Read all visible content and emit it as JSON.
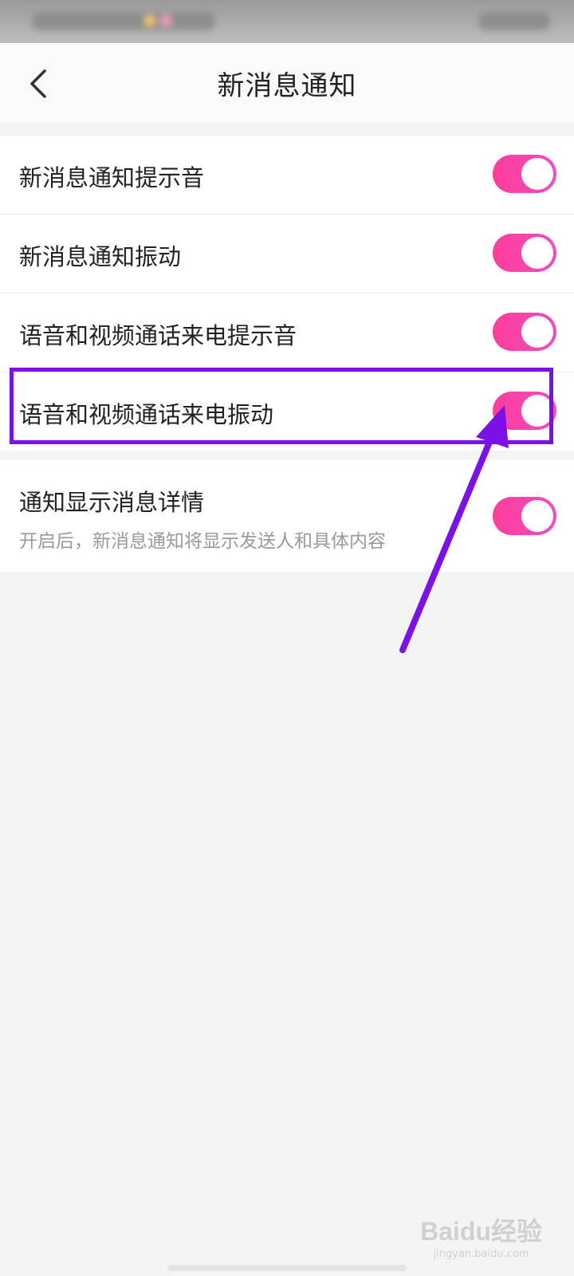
{
  "header": {
    "title": "新消息通知"
  },
  "settings": [
    {
      "label": "新消息通知提示音",
      "enabled": true
    },
    {
      "label": "新消息通知振动",
      "enabled": true
    },
    {
      "label": "语音和视频通话来电提示音",
      "enabled": true
    },
    {
      "label": "语音和视频通话来电振动",
      "enabled": true
    },
    {
      "label": "通知显示消息详情",
      "description": "开启后，新消息通知将显示发送人和具体内容",
      "enabled": true
    }
  ],
  "colors": {
    "toggle_on": "#ff3c9a",
    "highlight": "#7b10e8"
  },
  "watermark": {
    "main": "Baidu经验",
    "sub": "jingyan.baidu.com"
  }
}
